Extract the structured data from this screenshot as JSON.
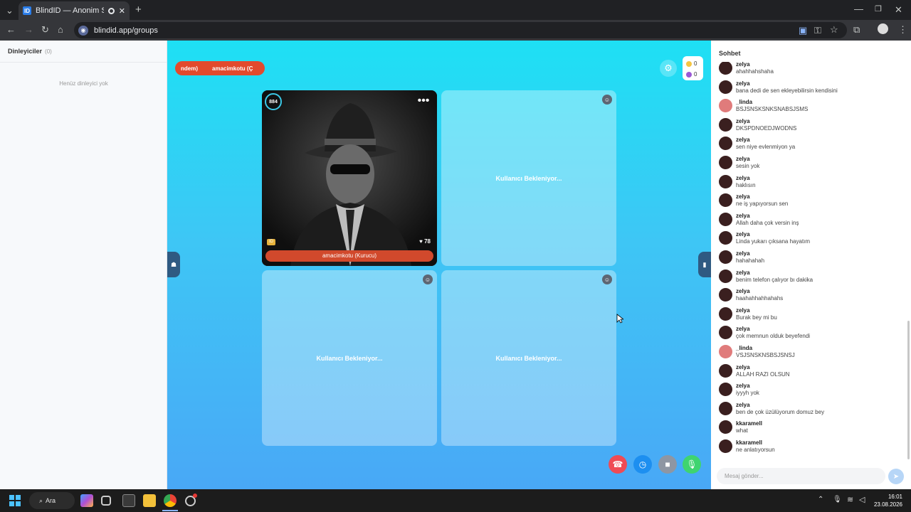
{
  "browser": {
    "tab_title": "BlindID — Anonim Sesli Sohbet",
    "new_tab": "+",
    "url": "blindid.app/groups"
  },
  "listeners": {
    "title": "Dinleyiciler",
    "count": "(0)",
    "empty": "Henüz dinleyici yok"
  },
  "stage": {
    "marquee": [
      "ndem)",
      "amacimkotu (Ç"
    ],
    "gold": "0",
    "gems": "0",
    "host": {
      "level": "884",
      "likes": "78",
      "badge": "ID",
      "name": "amacimkotu (Kurucu)"
    },
    "waiting_text": "Kullanıcı Bekleniyor..."
  },
  "chat": {
    "title": "Sohbet",
    "input_placeholder": "Mesaj gönder...",
    "messages": [
      {
        "user": "zelya",
        "text": "ahahhahshaha",
        "avatar": "dark"
      },
      {
        "user": "zelya",
        "text": "bana dedi de sen ekleyebilirsin kendisini",
        "avatar": "dark"
      },
      {
        "user": "_linda",
        "text": "BSJSNSKSNKSNABSJSMS",
        "avatar": "pink"
      },
      {
        "user": "zelya",
        "text": "DKSPDNOEDJWODNS",
        "avatar": "dark"
      },
      {
        "user": "zelya",
        "text": "sen niye evlenmiyon ya",
        "avatar": "dark"
      },
      {
        "user": "zelya",
        "text": "sesin yok",
        "avatar": "dark"
      },
      {
        "user": "zelya",
        "text": "haklısın",
        "avatar": "dark"
      },
      {
        "user": "zelya",
        "text": "ne iş yapıyorsun sen",
        "avatar": "dark"
      },
      {
        "user": "zelya",
        "text": "Allah daha çok versin inş",
        "avatar": "dark"
      },
      {
        "user": "zelya",
        "text": "Linda yukarı çıksana hayatım",
        "avatar": "dark"
      },
      {
        "user": "zelya",
        "text": "hahahahah",
        "avatar": "dark"
      },
      {
        "user": "zelya",
        "text": "benim telefon çalıyor bı dakika",
        "avatar": "dark"
      },
      {
        "user": "zelya",
        "text": "haahahhahhahahs",
        "avatar": "dark"
      },
      {
        "user": "zelya",
        "text": "Burak bey mi bu",
        "avatar": "dark"
      },
      {
        "user": "zelya",
        "text": "çok memnun olduk beyefendi",
        "avatar": "dark"
      },
      {
        "user": "_linda",
        "text": "VSJSNSKNSBSJSNSJ",
        "avatar": "pink"
      },
      {
        "user": "zelya",
        "text": "ALLAH RAZI OLSUN",
        "avatar": "dark"
      },
      {
        "user": "zelya",
        "text": "iyyyh yok",
        "avatar": "dark"
      },
      {
        "user": "zelya",
        "text": "ben de çok üzülüyorum domuz bey",
        "avatar": "dark"
      },
      {
        "user": "kkaramell",
        "text": "what",
        "avatar": "dark"
      },
      {
        "user": "kkaramell",
        "text": "ne anlatıyorsun",
        "avatar": "dark"
      }
    ]
  },
  "taskbar": {
    "search": "Ara",
    "time": "16:01",
    "date": "23.08.2026"
  },
  "colors": {
    "accent": "#e24a2d",
    "stage_top": "#1ee0f4",
    "stage_bottom": "#49a8f6"
  }
}
